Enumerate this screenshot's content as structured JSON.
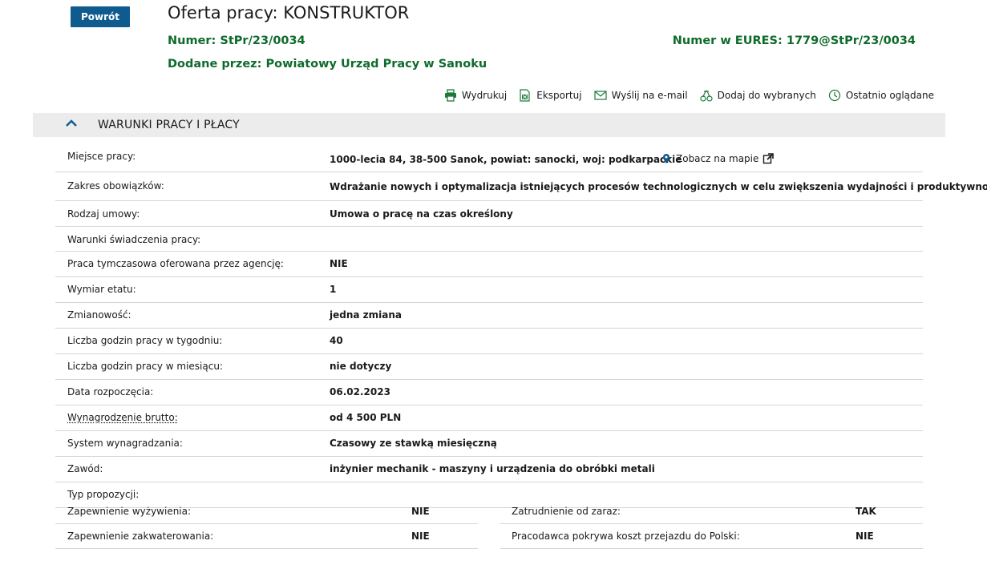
{
  "header": {
    "back_label": "Powrót",
    "title": "Oferta pracy: KONSTRUKTOR",
    "number_label": "Numer:",
    "number_value": "StPr/23/0034",
    "eures_label": "Numer w EURES:",
    "eures_value": "1779@StPr/23/0034",
    "added_label": "Dodane przez:",
    "added_value": "Powiatowy Urząd Pracy w Sanoku"
  },
  "actions": [
    {
      "label": "Wydrukuj",
      "icon": "printer-icon"
    },
    {
      "label": "Eksportuj",
      "icon": "export-icon"
    },
    {
      "label": "Wyślij na e-mail",
      "icon": "envelope-icon"
    },
    {
      "label": "Dodaj do wybranych",
      "icon": "cherries-icon"
    },
    {
      "label": "Ostatnio oglądane",
      "icon": "clock-icon"
    }
  ],
  "section": {
    "title": "WARUNKI PRACY I PŁACY"
  },
  "details": [
    {
      "label": "Miejsce pracy:",
      "value": "1000-lecia 84, 38-500 Sanok, powiat: sanocki, woj: podkarpackie",
      "map_link": "Zobacz na mapie"
    },
    {
      "label": "Zakres obowiązków:",
      "value": "Wdrażanie nowych i optymalizacja istniejących procesów technologicznych w celu zwiększenia wydajności i produktywności."
    },
    {
      "label": "Rodzaj umowy:",
      "value": "Umowa o pracę na czas określony"
    },
    {
      "label": "Warunki świadczenia pracy:",
      "value": ""
    },
    {
      "label": "Praca tymczasowa oferowana przez agencję:",
      "value": "NIE"
    },
    {
      "label": "Wymiar etatu:",
      "value": "1"
    },
    {
      "label": "Zmianowość:",
      "value": "jedna zmiana"
    },
    {
      "label": "Liczba godzin pracy w tygodniu:",
      "value": "40"
    },
    {
      "label": "Liczba godzin pracy w miesiącu:",
      "value": "nie dotyczy"
    },
    {
      "label": "Data rozpoczęcia:",
      "value": "06.02.2023"
    },
    {
      "label": "Wynagrodzenie brutto:",
      "value": "od 4 500 PLN"
    },
    {
      "label": "System wynagradzania:",
      "value": "Czasowy ze stawką miesięczną"
    },
    {
      "label": "Zawód:",
      "value": "inżynier mechanik - maszyny i urządzenia do obróbki metali"
    },
    {
      "label": "Typ propozycji:",
      "value": ""
    }
  ],
  "pairs": [
    {
      "left_label": "Zapewnienie wyżywienia:",
      "left_value": "NIE",
      "right_label": "Zatrudnienie od zaraz:",
      "right_value": "TAK"
    },
    {
      "left_label": "Zapewnienie zakwaterowania:",
      "left_value": "NIE",
      "right_label": "Pracodawca pokrywa koszt przejazdu do Polski:",
      "right_value": "NIE"
    }
  ],
  "colors": {
    "accent_blue": "#0f5a8f",
    "green": "#0e6b2b",
    "section_bg": "#ececec"
  }
}
